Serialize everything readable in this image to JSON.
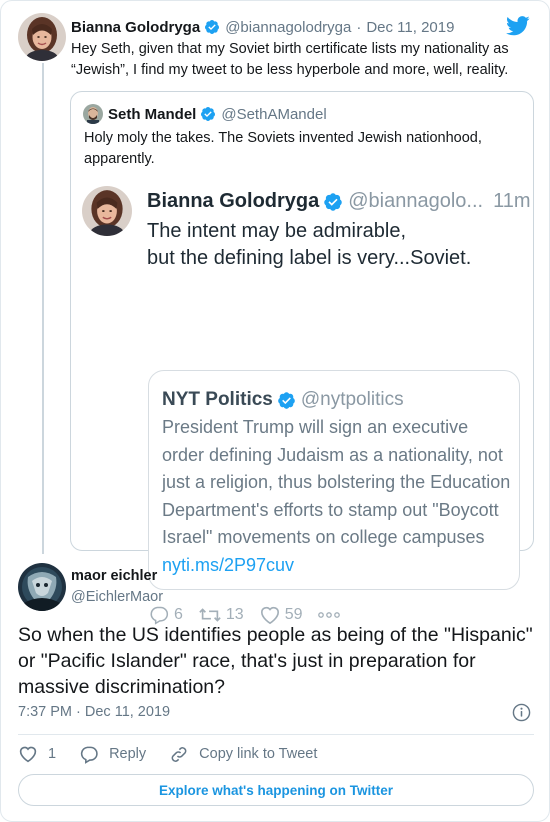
{
  "parent_tweet": {
    "author_name": "Bianna Golodryga",
    "author_handle": "@biannagolodryga",
    "separator": "·",
    "date": "Dec 11, 2019",
    "text": "Hey Seth, given that my Soviet birth certificate lists my nationality as “Jewish”, I find my tweet to be less hyperbole and more, well, reality.",
    "icons": {
      "verified": "verified-badge-icon",
      "brand": "twitter-bird-icon"
    }
  },
  "quoted_tweet": {
    "author_name": "Seth Mandel",
    "author_handle": "@SethAMandel",
    "text": "Holy moly the takes. The Soviets invented Jewish nationhood, apparently.",
    "embedded_screenshot": {
      "author_name": "Bianna Golodryga",
      "author_handle": "@biannagolo...",
      "time": "11m",
      "text_line1": "The intent may be admirable,",
      "text_line2": "but the defining label is very...Soviet.",
      "inner_quote": {
        "author_name": "NYT Politics",
        "author_handle": "@nytpolitics",
        "text": "President Trump will sign an executive order defining Judaism as a nationality, not just a religion, thus bolstering the Education Department's efforts to stamp out \"Boycott Israel\" movements on college campuses",
        "link": "nyti.ms/2P97cuv"
      },
      "replies": "6",
      "retweets": "13",
      "likes": "59"
    }
  },
  "reply_tweet": {
    "author_name": "maor eichler",
    "author_handle": "@EichlerMaor",
    "text": "So when the US identifies people as being of the \"Hispanic\" or \"Pacific Islander\" race, that's just in preparation for massive discrimination?",
    "timestamp": "7:37 PM · Dec 11, 2019",
    "like_count": "1",
    "reply_label": "Reply",
    "copy_link_label": "Copy link to Tweet"
  },
  "explore_button": {
    "label": "Explore what's happening on Twitter"
  },
  "colors": {
    "twitter_blue": "#1da1f2",
    "link_blue": "#1b95e0",
    "text_primary": "#14171a",
    "text_secondary": "#657786",
    "border": "#ccd6dd"
  }
}
